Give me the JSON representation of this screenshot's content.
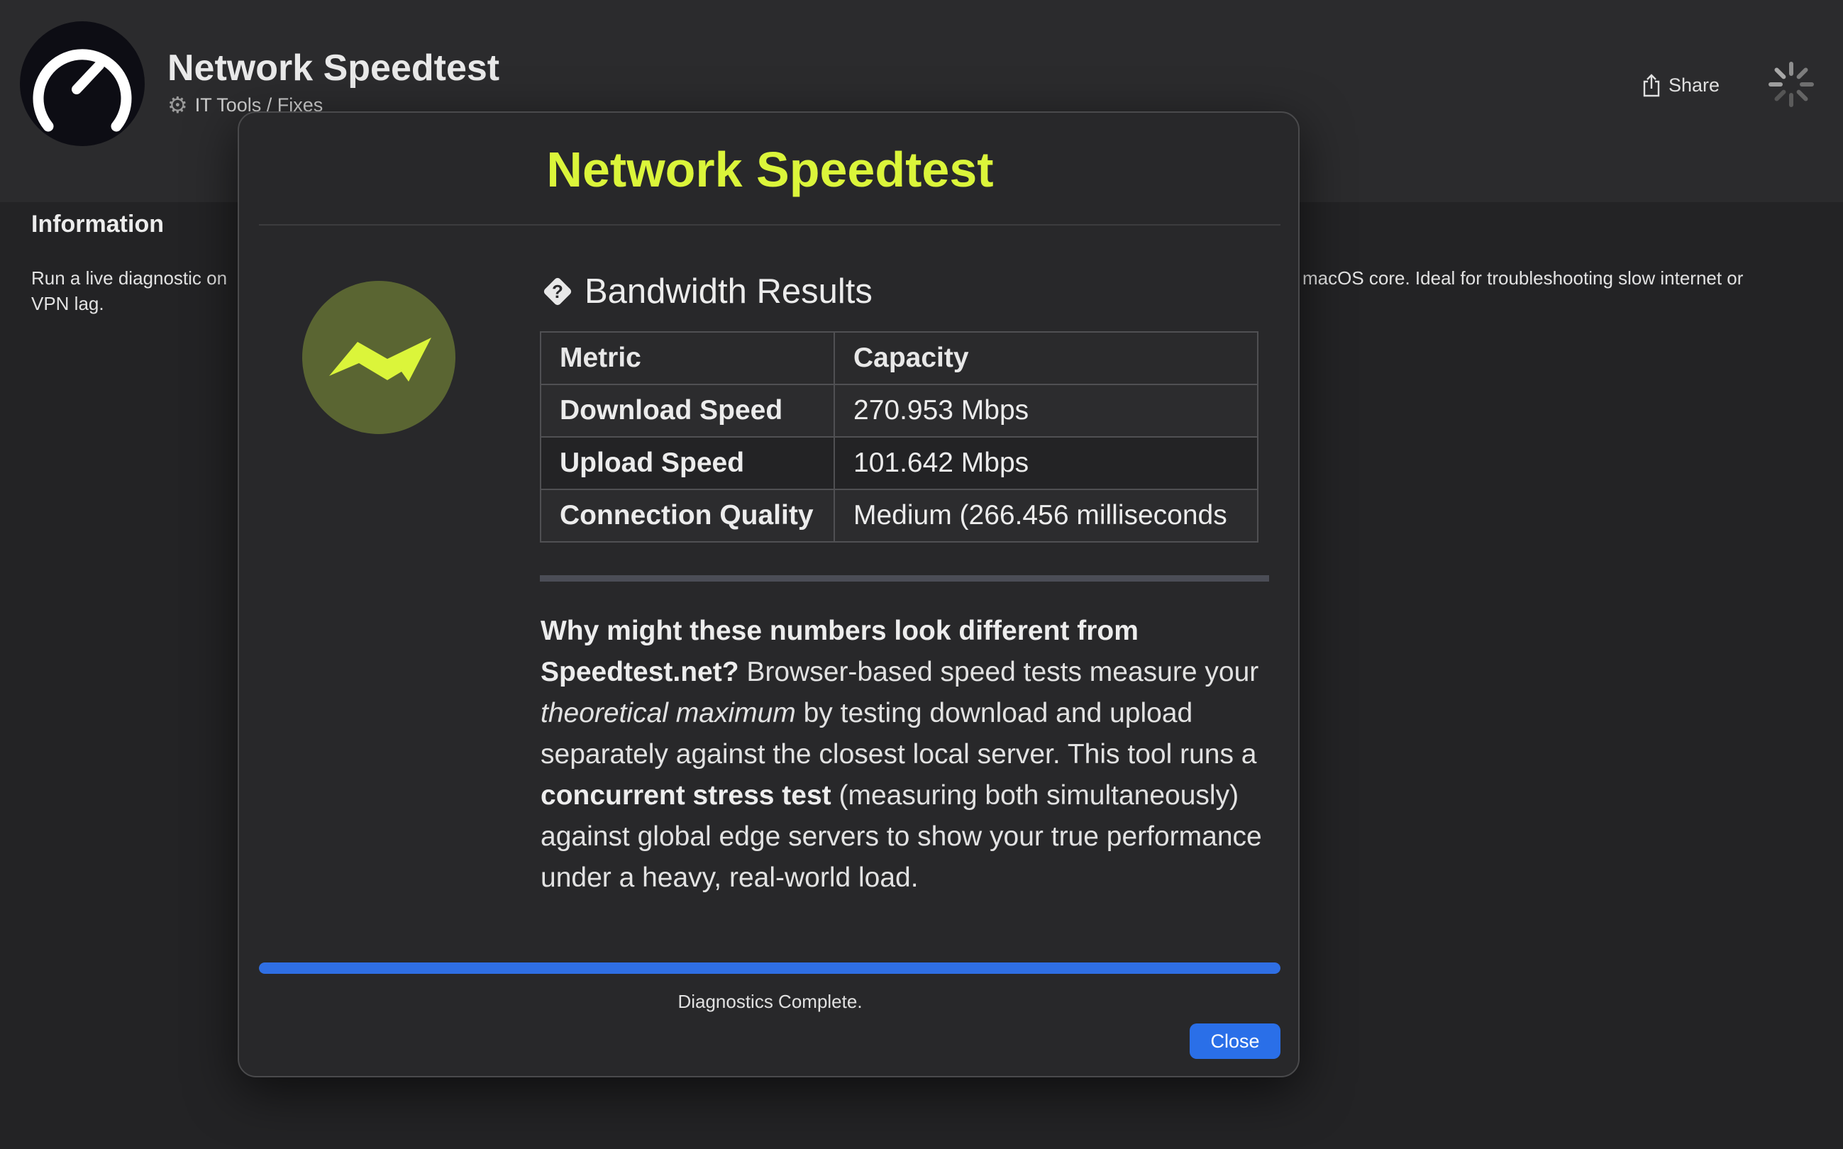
{
  "app": {
    "title": "Network Speedtest",
    "category": "IT Tools / Fixes",
    "share_label": "Share"
  },
  "info": {
    "heading": "Information",
    "text_left": "Run a live diagnostic on VPN lag.",
    "text_right": "macOS core. Ideal for troubleshooting slow internet or"
  },
  "modal": {
    "title": "Network Speedtest",
    "section_heading": "Bandwidth Results",
    "table": {
      "headers": [
        "Metric",
        "Capacity"
      ],
      "rows": [
        [
          "Download Speed",
          "270.953 Mbps"
        ],
        [
          "Upload Speed",
          "101.642 Mbps"
        ],
        [
          "Connection Quality",
          "Medium (266.456 milliseconds"
        ]
      ]
    },
    "explanation": {
      "q_bold": "Why might these numbers look different from Speedtest.net?",
      "part1": " Browser-based speed tests measure your ",
      "italic": "theoretical maximum",
      "part2": " by testing download and upload separately against the closest local server. This tool runs a ",
      "bold2": "concurrent stress test",
      "part3": " (measuring both simultaneously) against global edge servers to show your true performance under a heavy, real-world load."
    },
    "progress_percent": 100,
    "status": "Diagnostics Complete.",
    "close_label": "Close"
  },
  "colors": {
    "accent_title": "#dbf53a",
    "progress": "#2f6fe4",
    "button": "#2a6fe8",
    "badge_bg": "#5a6532"
  },
  "icons": {
    "app": "speedometer-icon",
    "category": "gear-icon",
    "share": "share-icon",
    "spinner": "loading-spinner-icon",
    "section": "question-diamond-icon",
    "badge": "lightning-wave-icon"
  }
}
